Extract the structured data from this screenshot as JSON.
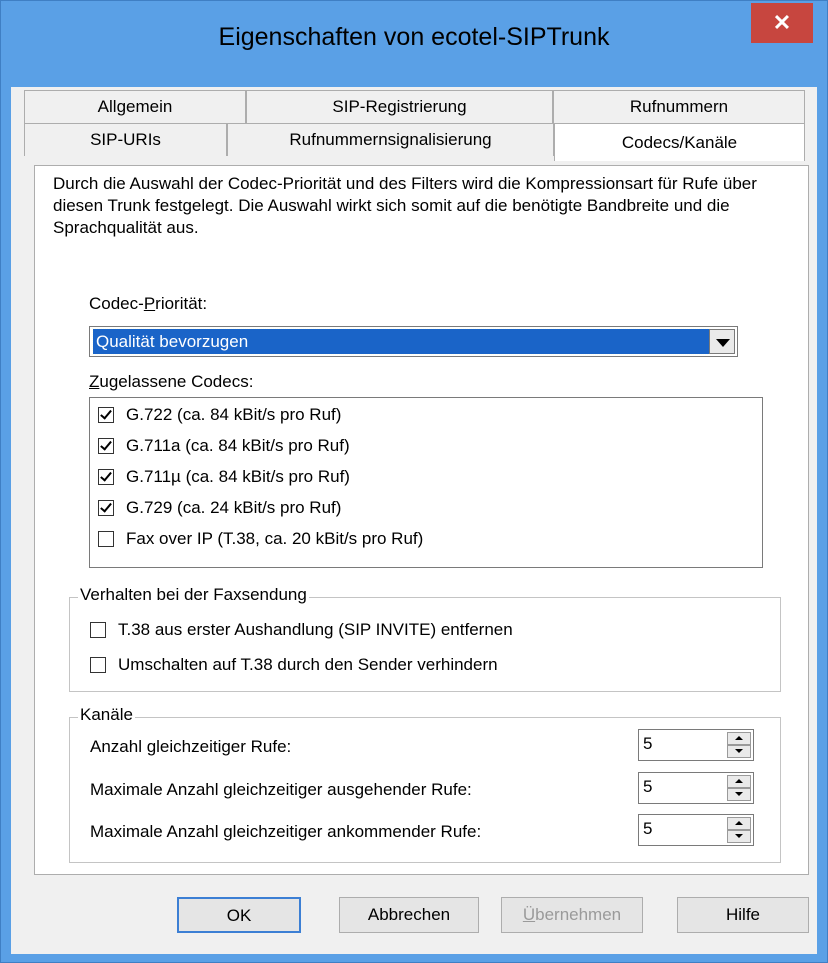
{
  "window": {
    "title": "Eigenschaften von ecotel-SIPTrunk",
    "close_label": "✕"
  },
  "tabs": {
    "row1": [
      "Allgemein",
      "SIP-Registrierung",
      "Rufnummern"
    ],
    "row2": [
      "SIP-URIs",
      "Rufnummernsignalisierung",
      "Codecs/Kanäle"
    ],
    "active": "Codecs/Kanäle"
  },
  "description": "Durch die Auswahl der Codec-Priorität und des Filters wird die Kompressionsart für Rufe über diesen Trunk festgelegt. Die Auswahl wirkt sich somit auf die benötigte Bandbreite und die Sprachqualität aus.",
  "codec_priority": {
    "label_pre": "Codec-",
    "label_u": "P",
    "label_post": "riorität:",
    "value": "Qualität bevorzugen"
  },
  "allowed_codecs": {
    "label_u": "Z",
    "label_post": "ugelassene Codecs:",
    "items": [
      {
        "label": "G.722 (ca. 84 kBit/s pro Ruf)",
        "checked": true
      },
      {
        "label": "G.711a (ca. 84 kBit/s pro Ruf)",
        "checked": true
      },
      {
        "label": "G.711µ (ca. 84 kBit/s pro Ruf)",
        "checked": true
      },
      {
        "label": "G.729 (ca. 24 kBit/s pro Ruf)",
        "checked": true
      },
      {
        "label": "Fax over IP (T.38, ca. 20 kBit/s pro Ruf)",
        "checked": false
      }
    ]
  },
  "fax": {
    "title": "Verhalten bei der Faxsendung",
    "opt1": "T.38 aus erster Aushandlung (SIP INVITE) entfernen",
    "opt2": "Umschalten auf T.38 durch den Sender verhindern"
  },
  "channels": {
    "title": "Kanäle",
    "rows": [
      {
        "label": "Anzahl gleichzeitiger Rufe:",
        "value": "5"
      },
      {
        "label": "Maximale Anzahl gleichzeitiger ausgehender Rufe:",
        "value": "5"
      },
      {
        "label": "Maximale Anzahl gleichzeitiger ankommender Rufe:",
        "value": "5"
      }
    ]
  },
  "buttons": {
    "ok": "OK",
    "cancel": "Abbrechen",
    "apply_u": "Ü",
    "apply_rest": "bernehmen",
    "help": "Hilfe"
  }
}
